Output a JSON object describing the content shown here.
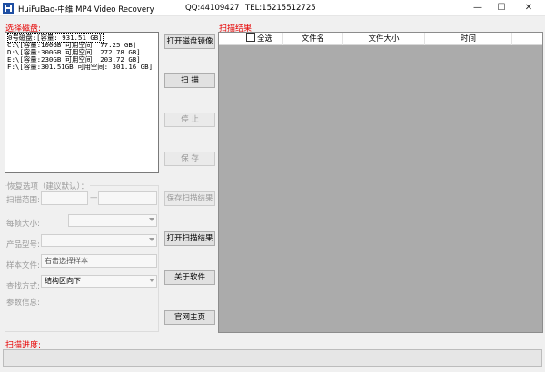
{
  "window": {
    "title": "HuiFuBao-中维 MP4 Video Recovery",
    "qq": "QQ:44109427",
    "tel": "TEL:15215512725",
    "min_glyph": "—",
    "max_glyph": "☐",
    "close_glyph": "✕"
  },
  "disk_panel": {
    "label": "选择磁盘:",
    "items": [
      "0号磁盘:[容量: 931.51 GB]",
      "C:\\[容量:100GB 可用空间: 77.25 GB]",
      "D:\\[容量:300GB 可用空间: 272.78 GB]",
      "E:\\[容量:230GB 可用空间: 203.72 GB]",
      "F:\\[容量:301.51GB 可用空间: 301.16 GB]"
    ],
    "selected_index": 0
  },
  "buttons": {
    "open_image": "打开磁盘镜像",
    "scan": "扫  描",
    "stop": "停  止",
    "save": "保  存",
    "save_results": "保存扫描结果",
    "open_results": "打开扫描结果",
    "about": "关于软件",
    "homepage": "官网主页"
  },
  "options": {
    "title": "恢复选项（建议默认）：",
    "scan_range_label": "扫描范围:",
    "scan_range_from": "",
    "scan_range_sep": "—",
    "scan_range_to": "",
    "frame_size_label": "每帧大小:",
    "frame_size_value": "",
    "product_model_label": "产品型号:",
    "product_model_value": "",
    "sample_file_label": "样本文件:",
    "sample_file_value": "右击选择样本",
    "search_mode_label": "查找方式:",
    "search_mode_value": "结构区向下",
    "params_label": "参数信息:"
  },
  "results": {
    "label": "扫描结果:",
    "select_all": "全选",
    "col_name": "文件名",
    "col_size": "文件大小",
    "col_time": "时间",
    "rows": []
  },
  "progress": {
    "label": "扫描进度:",
    "value": 0
  },
  "colors": {
    "accent_label": "#e60000",
    "results_background": "#ababab",
    "progress_fill": "#06b025"
  },
  "icons": {
    "app": "app-logo-icon",
    "dropdown": "chevron-down-icon"
  }
}
